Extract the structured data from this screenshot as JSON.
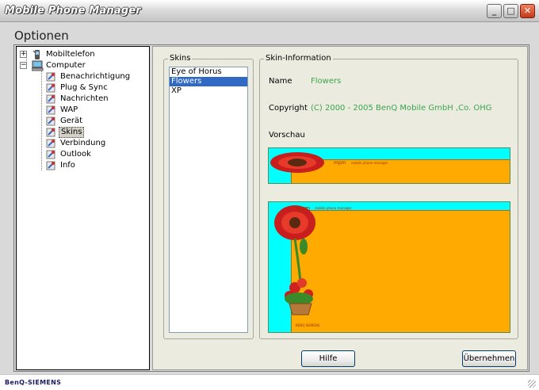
{
  "window": {
    "title": "Mobile Phone Manager",
    "min_glyph": "_",
    "max_glyph": "□",
    "close_glyph": "✕"
  },
  "page": {
    "heading": "Optionen"
  },
  "tree": {
    "root1": "Mobiltelefon",
    "root2": "Computer",
    "children": [
      "Benachrichtigung",
      "Plug & Sync",
      "Nachrichten",
      "WAP",
      "Gerät",
      "Skins",
      "Verbindung",
      "Outlook",
      "Info"
    ],
    "selected": "Skins",
    "expand_plus": "+",
    "expand_minus": "−"
  },
  "skins": {
    "group_label": "Skins",
    "items": [
      "Eye of Horus",
      "Flowers",
      "XP"
    ],
    "selected": "Flowers"
  },
  "skin_info": {
    "group_label": "Skin-Information",
    "name_label": "Name",
    "name_value": "Flowers",
    "copyright_label": "Copyright",
    "copyright_value": "(C) 2000 - 2005 BenQ Mobile GmbH ,Co. OHG",
    "preview_label": "Vorschau",
    "preview_brand": "mpm",
    "preview_sub": "mobile phone manager",
    "preview_logo": "BENQ SIEMENS"
  },
  "buttons": {
    "help": "Hilfe",
    "apply": "Übernehmen"
  },
  "footer": {
    "brand": "BenQ-SIEMENS"
  },
  "colors": {
    "accent_green": "#3aa64a",
    "select_blue": "#316ac5",
    "preview_orange": "#ffaa00",
    "preview_cyan": "#00ffff"
  }
}
